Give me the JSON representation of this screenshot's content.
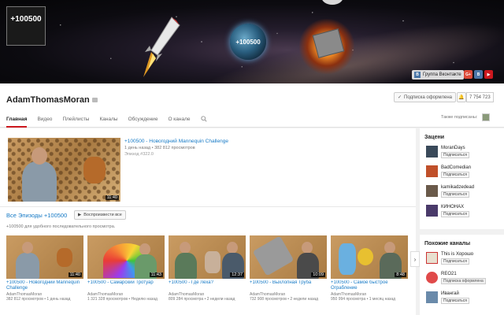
{
  "banner": {
    "avatar_text": "+100500",
    "logo_text": "+100500",
    "vk_icon": "В",
    "vk_label": "Группа Вконтакте",
    "social_icons": [
      "G+",
      "В",
      "▶"
    ]
  },
  "channel": {
    "name": "AdamThomasMoran",
    "subscribe_label": "Подписка оформлена",
    "subscriber_count": "7 754 723",
    "also_subscribed": "Также подписаны:"
  },
  "tabs": [
    "Главная",
    "Видео",
    "Плейлисты",
    "Каналы",
    "Обсуждение",
    "О канале"
  ],
  "featured": {
    "title": "+100500 - Новогодний Mannequin Challenge",
    "meta": "1 день назад • 382 812 просмотров",
    "episode": "Эпизод #322.0",
    "duration": "11:40"
  },
  "section": {
    "title": "Все Эпизоды +100500",
    "play_all": "Воспроизвести все",
    "description": "+100500 для удобного последовательного просмотра."
  },
  "cards": [
    {
      "title": "+100500 - Новогодний Mannequin Challenge",
      "channel": "AdamThomasMoran",
      "meta": "382 812 просмотров • 1 день назад",
      "duration": "11:40"
    },
    {
      "title": "+100500 - Самарский Тротуар",
      "channel": "AdamThomasMoran",
      "meta": "1 321 328 просмотров • Неделю назад",
      "duration": "11:43"
    },
    {
      "title": "+100500 - Где Леха?",
      "channel": "AdamThomasMoran",
      "meta": "809 284 просмотра • 2 недели назад",
      "duration": "12:37"
    },
    {
      "title": "+100500 - Выхлопная Труба",
      "channel": "AdamThomasMoran",
      "meta": "732 908 просмотров • 2 недели назад",
      "duration": "10:09"
    },
    {
      "title": "+100500 - Самое быстрое Ограбление",
      "channel": "AdamThomasMoran",
      "meta": "950 994 просмотра • 1 месяц назад",
      "duration": "8:48"
    }
  ],
  "sidebar": {
    "featured_heading": "Зацени",
    "featured_channels": [
      {
        "name": "MoranDays",
        "button": "Подписаться",
        "color": "#3a4a5a"
      },
      {
        "name": "BadComedian",
        "button": "Подписаться",
        "color": "#c0502a"
      },
      {
        "name": "kamikadzedead",
        "button": "Подписаться",
        "color": "#6a5a4a"
      },
      {
        "name": "КИНОНАХ",
        "button": "Подписаться",
        "color": "#4a3a6a"
      }
    ],
    "related_heading": "Похожие каналы",
    "related_channels": [
      {
        "name": "This is Хорошо",
        "button": "Подписаться",
        "color": "#e8e0d0"
      },
      {
        "name": "REO21",
        "button": "Подписка оформлена",
        "color": "#e04a4a"
      },
      {
        "name": "Ивангай",
        "button": "Подписаться",
        "color": "#6a8aaa"
      }
    ]
  },
  "colors": {
    "accent": "#cc181e",
    "link": "#167ac6"
  }
}
